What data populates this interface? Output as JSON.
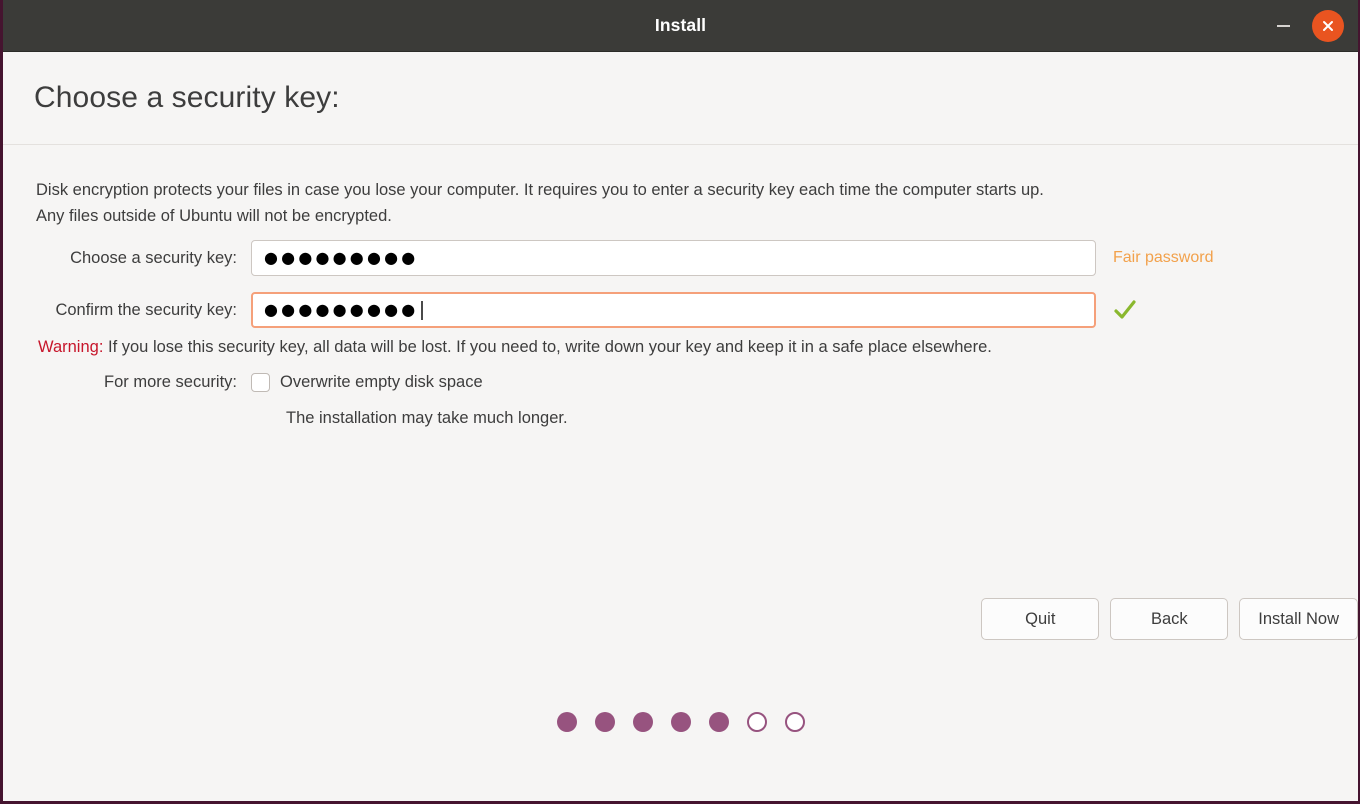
{
  "window": {
    "title": "Install",
    "minimize_icon": "minimize-icon",
    "close_icon": "close-icon",
    "titlebar_color": "#3b3b38",
    "border_color": "#45142f",
    "close_button_color": "#e95420"
  },
  "header": {
    "page_title": "Choose a security key:"
  },
  "body": {
    "intro_line1": "Disk encryption protects your files in case you lose your computer. It requires you to enter a security key each time the computer starts up.",
    "intro_line2": "Any files outside of Ubuntu will not be encrypted."
  },
  "form": {
    "choose": {
      "label": "Choose a security key:",
      "value": "●●●●●●●●●",
      "placeholder": "",
      "strength_text": "Fair password",
      "strength_color": "#f2a14b",
      "focused": false
    },
    "confirm": {
      "label": "Confirm the security key:",
      "value": "●●●●●●●●●",
      "placeholder": "",
      "match_icon": "checkmark-icon",
      "match_color": "#8ab82e",
      "focused": true
    }
  },
  "warning": {
    "prefix": "Warning:",
    "prefix_color": "#c7162b",
    "text": " If you lose this security key, all data will be lost. If you need to, write down your key and keep it in a safe place elsewhere."
  },
  "security_option": {
    "label": "For more security:",
    "checkbox_label": "Overwrite empty disk space",
    "checked": false,
    "note": "The installation may take much longer."
  },
  "buttons": {
    "quit": "Quit",
    "back": "Back",
    "install_now": "Install Now"
  },
  "progress": {
    "total_steps": 7,
    "completed_steps": 5,
    "active_color": "#97537f",
    "steps": [
      {
        "state": "filled"
      },
      {
        "state": "filled"
      },
      {
        "state": "filled"
      },
      {
        "state": "filled"
      },
      {
        "state": "filled"
      },
      {
        "state": "hollow"
      },
      {
        "state": "hollow"
      }
    ]
  }
}
